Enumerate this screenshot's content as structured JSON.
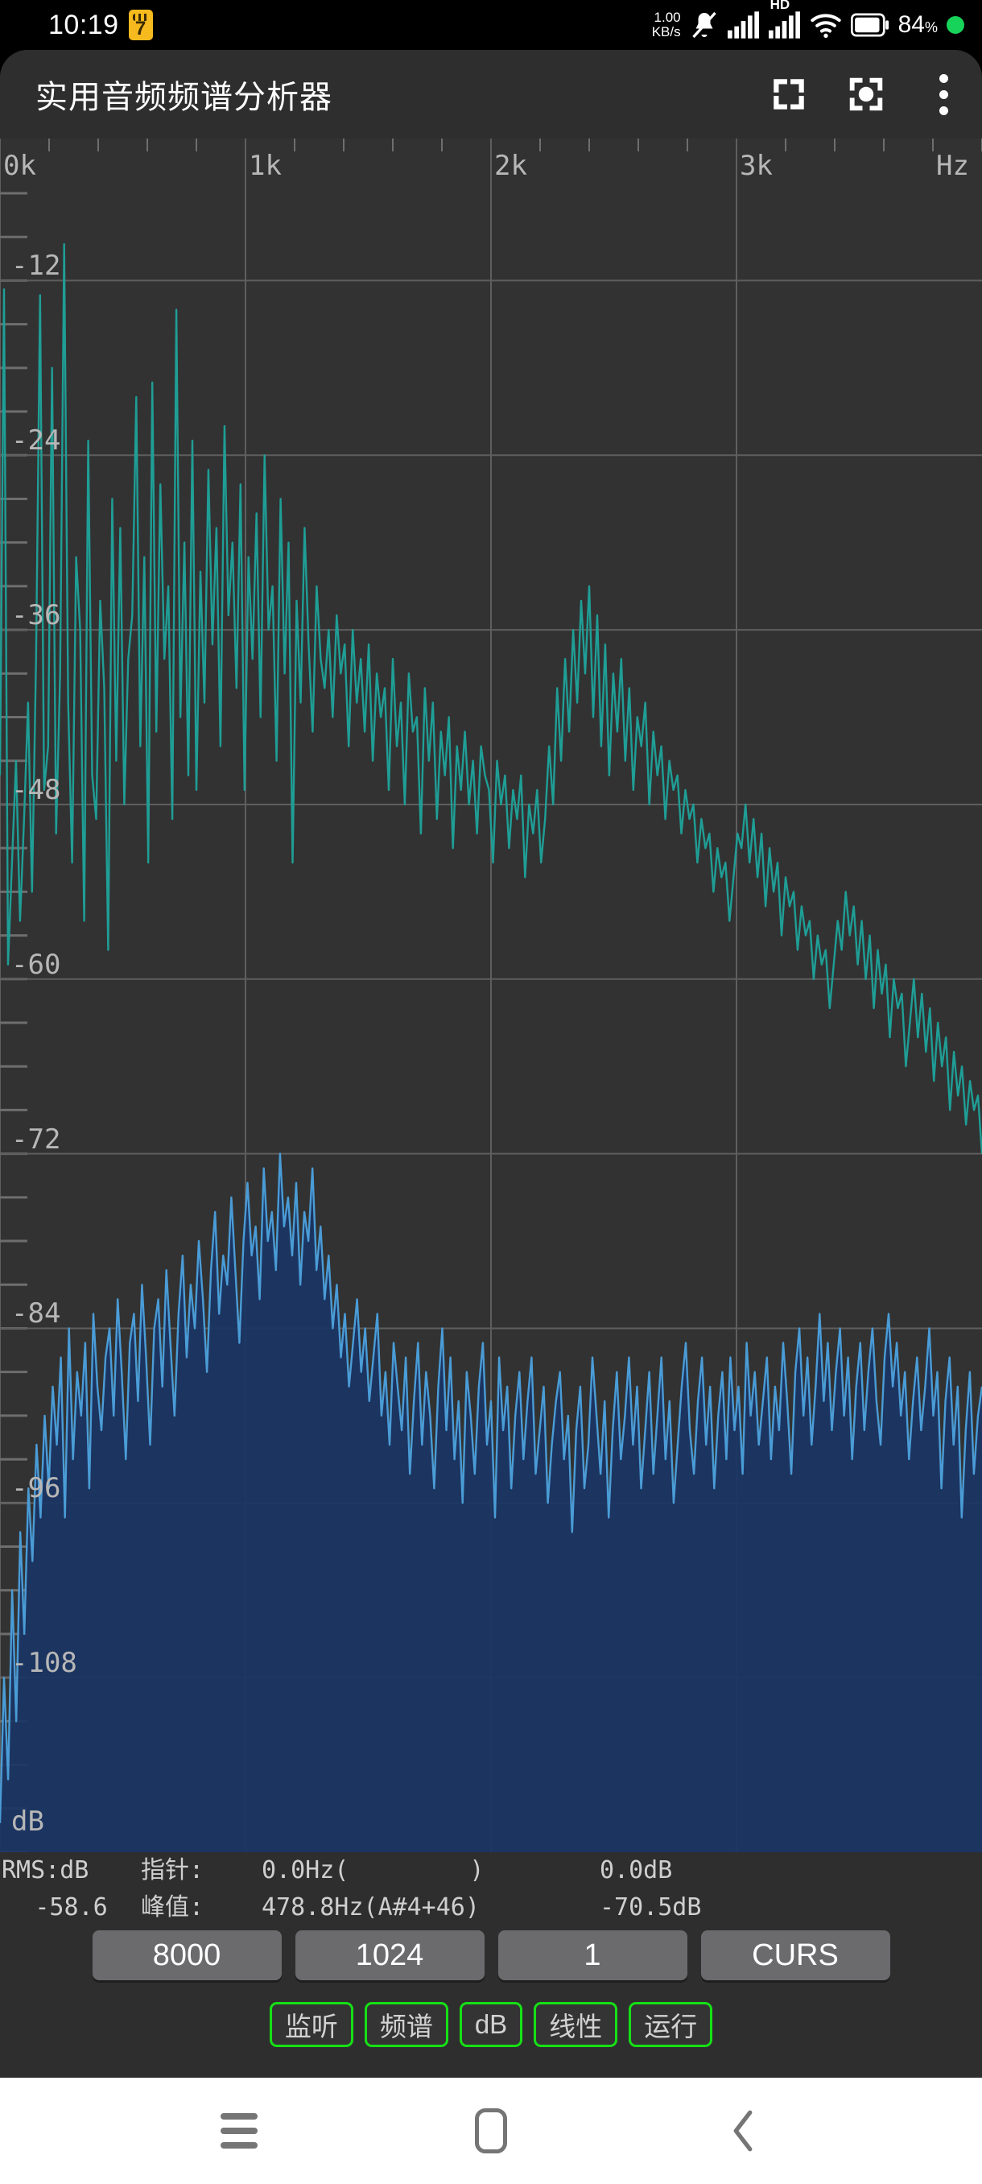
{
  "status_bar": {
    "time": "10:19",
    "badge_icon": "ruler-badge-icon",
    "badge_text": "7",
    "net_speed_value": "1.00",
    "net_speed_unit": "KB/s",
    "icons": [
      "mute-bell-icon",
      "signal-bars-icon",
      "hd-signal-icon",
      "wifi-icon",
      "battery-icon"
    ],
    "hd_label": "HD",
    "battery_percent": "84",
    "percent_symbol": "%"
  },
  "app_bar": {
    "title": "实用音频频谱分析器",
    "actions": [
      {
        "name": "fullscreen-icon",
        "label": "全屏"
      },
      {
        "name": "center-focus-icon",
        "label": "对焦"
      },
      {
        "name": "overflow-menu-icon",
        "label": "更多"
      }
    ]
  },
  "chart_data": {
    "type": "line",
    "title": "",
    "xlabel": "Hz",
    "ylabel": "dB",
    "xlim": [
      0,
      4000
    ],
    "ylim": [
      -120,
      -6
    ],
    "grid": true,
    "legend": "none",
    "x_unit_label": "Hz",
    "y_unit_label": "dB",
    "x_tick_labels": [
      "0k",
      "1k",
      "2k",
      "3k"
    ],
    "x_tick_values": [
      0,
      1000,
      2000,
      3000
    ],
    "x_minor_tick_step": 200,
    "y_tick_labels": [
      "-12",
      "-24",
      "-36",
      "-48",
      "-60",
      "-72",
      "-84",
      "-96",
      "-108"
    ],
    "y_tick_values": [
      -12,
      -24,
      -36,
      -48,
      -60,
      -72,
      -84,
      -96,
      -108
    ],
    "y_minor_tick_step": 3,
    "series": [
      {
        "name": "spectrum-peak-hold",
        "color": "#1f9e96",
        "filled": false,
        "values": [
          -46,
          -12.6,
          -59,
          -52,
          -45,
          -56,
          -49,
          -41,
          -54,
          -38,
          -13,
          -47,
          -44,
          -18,
          -50,
          -39,
          -9.5,
          -41,
          -52,
          -31,
          -36,
          -56,
          -23,
          -46,
          -49,
          -34,
          -40,
          -58,
          -27,
          -45,
          -29,
          -48,
          -38,
          -35,
          -20,
          -44,
          -31,
          -52,
          -19,
          -43,
          -26,
          -38,
          -33,
          -49,
          -14,
          -42,
          -30,
          -46,
          -23,
          -47,
          -32,
          -41,
          -25,
          -37,
          -29,
          -44,
          -22,
          -35,
          -30,
          -40,
          -26,
          -47,
          -31,
          -38,
          -28,
          -42,
          -24,
          -36,
          -33,
          -45,
          -27,
          -39,
          -30,
          -52,
          -34,
          -41,
          -29,
          -37,
          -43,
          -33,
          -38,
          -40,
          -36,
          -42,
          -35,
          -39,
          -37,
          -44,
          -36,
          -41,
          -38,
          -43,
          -37,
          -45,
          -39,
          -42,
          -40,
          -47,
          -38,
          -44,
          -41,
          -48,
          -39,
          -43,
          -42,
          -50,
          -40,
          -45,
          -41,
          -49,
          -43,
          -46,
          -42,
          -51,
          -44,
          -47,
          -43,
          -48,
          -45,
          -50,
          -44,
          -46,
          -47,
          -52,
          -45,
          -48,
          -46,
          -51,
          -47,
          -49,
          -46,
          -53,
          -48,
          -50,
          -47,
          -52,
          -49,
          -44,
          -48,
          -40,
          -45,
          -38,
          -43,
          -36,
          -41,
          -34,
          -39,
          -33,
          -42,
          -35,
          -44,
          -37,
          -46,
          -39,
          -43,
          -38,
          -45,
          -40,
          -47,
          -42,
          -44,
          -41,
          -48,
          -43,
          -46,
          -44,
          -49,
          -45,
          -47,
          -46,
          -50,
          -47,
          -49,
          -48,
          -52,
          -49,
          -51,
          -50,
          -54,
          -51,
          -53,
          -52,
          -56,
          -53,
          -50,
          -51,
          -48,
          -52,
          -49,
          -53,
          -50,
          -55,
          -51,
          -54,
          -52,
          -57,
          -53,
          -55,
          -54,
          -58,
          -55,
          -57,
          -56,
          -60,
          -57,
          -59,
          -58,
          -62,
          -59,
          -56,
          -58,
          -54,
          -57,
          -55,
          -59,
          -56,
          -60,
          -57,
          -62,
          -58,
          -61,
          -59,
          -64,
          -60,
          -62,
          -61,
          -66,
          -63,
          -60,
          -64,
          -61,
          -65,
          -62,
          -67,
          -63,
          -66,
          -64,
          -69,
          -65,
          -68,
          -66,
          -70,
          -67,
          -69,
          -68,
          -72
        ]
      },
      {
        "name": "spectrum-live",
        "color": "#4a9cd6",
        "fill_color": "#1b3564",
        "filled": true,
        "values": [
          -118,
          -108,
          -115,
          -102,
          -111,
          -98,
          -105,
          -95,
          -100,
          -92,
          -97,
          -90,
          -95,
          -88,
          -92,
          -86,
          -97,
          -84,
          -93,
          -87,
          -90,
          -85,
          -95,
          -83,
          -88,
          -91,
          -86,
          -84,
          -90,
          -82,
          -87,
          -93,
          -85,
          -83,
          -89,
          -81,
          -86,
          -92,
          -84,
          -82,
          -88,
          -80,
          -85,
          -90,
          -83,
          -79,
          -86,
          -81,
          -84,
          -78,
          -82,
          -87,
          -80,
          -76,
          -83,
          -79,
          -81,
          -75,
          -80,
          -85,
          -78,
          -74,
          -79,
          -77,
          -82,
          -73,
          -78,
          -76,
          -80,
          -72,
          -77,
          -75,
          -79,
          -74,
          -81,
          -76,
          -78,
          -73,
          -80,
          -77,
          -82,
          -79,
          -84,
          -81,
          -86,
          -83,
          -88,
          -85,
          -82,
          -87,
          -84,
          -89,
          -86,
          -83,
          -90,
          -87,
          -92,
          -85,
          -88,
          -91,
          -86,
          -94,
          -89,
          -85,
          -92,
          -87,
          -90,
          -95,
          -88,
          -84,
          -91,
          -86,
          -93,
          -89,
          -96,
          -87,
          -90,
          -94,
          -88,
          -85,
          -92,
          -89,
          -97,
          -86,
          -91,
          -88,
          -95,
          -90,
          -87,
          -93,
          -89,
          -86,
          -94,
          -91,
          -88,
          -96,
          -92,
          -89,
          -87,
          -93,
          -90,
          -98,
          -91,
          -88,
          -95,
          -92,
          -86,
          -90,
          -94,
          -89,
          -97,
          -91,
          -87,
          -93,
          -90,
          -86,
          -92,
          -88,
          -95,
          -91,
          -87,
          -94,
          -90,
          -86,
          -93,
          -89,
          -96,
          -92,
          -88,
          -85,
          -91,
          -94,
          -89,
          -86,
          -92,
          -88,
          -95,
          -90,
          -87,
          -93,
          -86,
          -91,
          -88,
          -94,
          -85,
          -90,
          -87,
          -92,
          -89,
          -86,
          -93,
          -88,
          -91,
          -85,
          -89,
          -94,
          -87,
          -84,
          -90,
          -86,
          -92,
          -88,
          -83,
          -89,
          -85,
          -91,
          -87,
          -84,
          -90,
          -86,
          -93,
          -88,
          -85,
          -91,
          -87,
          -84,
          -89,
          -92,
          -86,
          -83,
          -88,
          -85,
          -90,
          -87,
          -93,
          -89,
          -86,
          -91,
          -88,
          -84,
          -90,
          -87,
          -95,
          -89,
          -86,
          -92,
          -88,
          -97,
          -91,
          -87,
          -94,
          -90,
          -88
        ]
      }
    ]
  },
  "readout": {
    "rms_label": "RMS:dB",
    "rms_value": "-58.6",
    "cursor_label": "指针:",
    "cursor_freq": "0.0Hz(",
    "cursor_note": "",
    "cursor_note_close": ")",
    "cursor_db": "0.0dB",
    "peak_label": "峰值:",
    "peak_freq": "478.8Hz(A#4+46)",
    "peak_db": "-70.5dB"
  },
  "controls": {
    "row1": [
      {
        "name": "sample-rate-button",
        "label": "8000"
      },
      {
        "name": "fft-size-button",
        "label": "1024"
      },
      {
        "name": "average-button",
        "label": "1"
      },
      {
        "name": "cursor-button",
        "label": "CURS"
      }
    ],
    "row2": [
      {
        "name": "monitor-toggle",
        "label": "监听"
      },
      {
        "name": "spectrum-mode-toggle",
        "label": "频谱"
      },
      {
        "name": "db-scale-toggle",
        "label": "dB"
      },
      {
        "name": "linear-scale-toggle",
        "label": "线性"
      },
      {
        "name": "run-toggle",
        "label": "运行"
      }
    ],
    "accent_color": "#16E016",
    "button_color": "#6b6b6e"
  },
  "nav_bar": {
    "items": [
      {
        "name": "recents-icon",
        "label": "最近任务"
      },
      {
        "name": "home-icon",
        "label": "主页"
      },
      {
        "name": "back-icon",
        "label": "返回"
      }
    ]
  }
}
